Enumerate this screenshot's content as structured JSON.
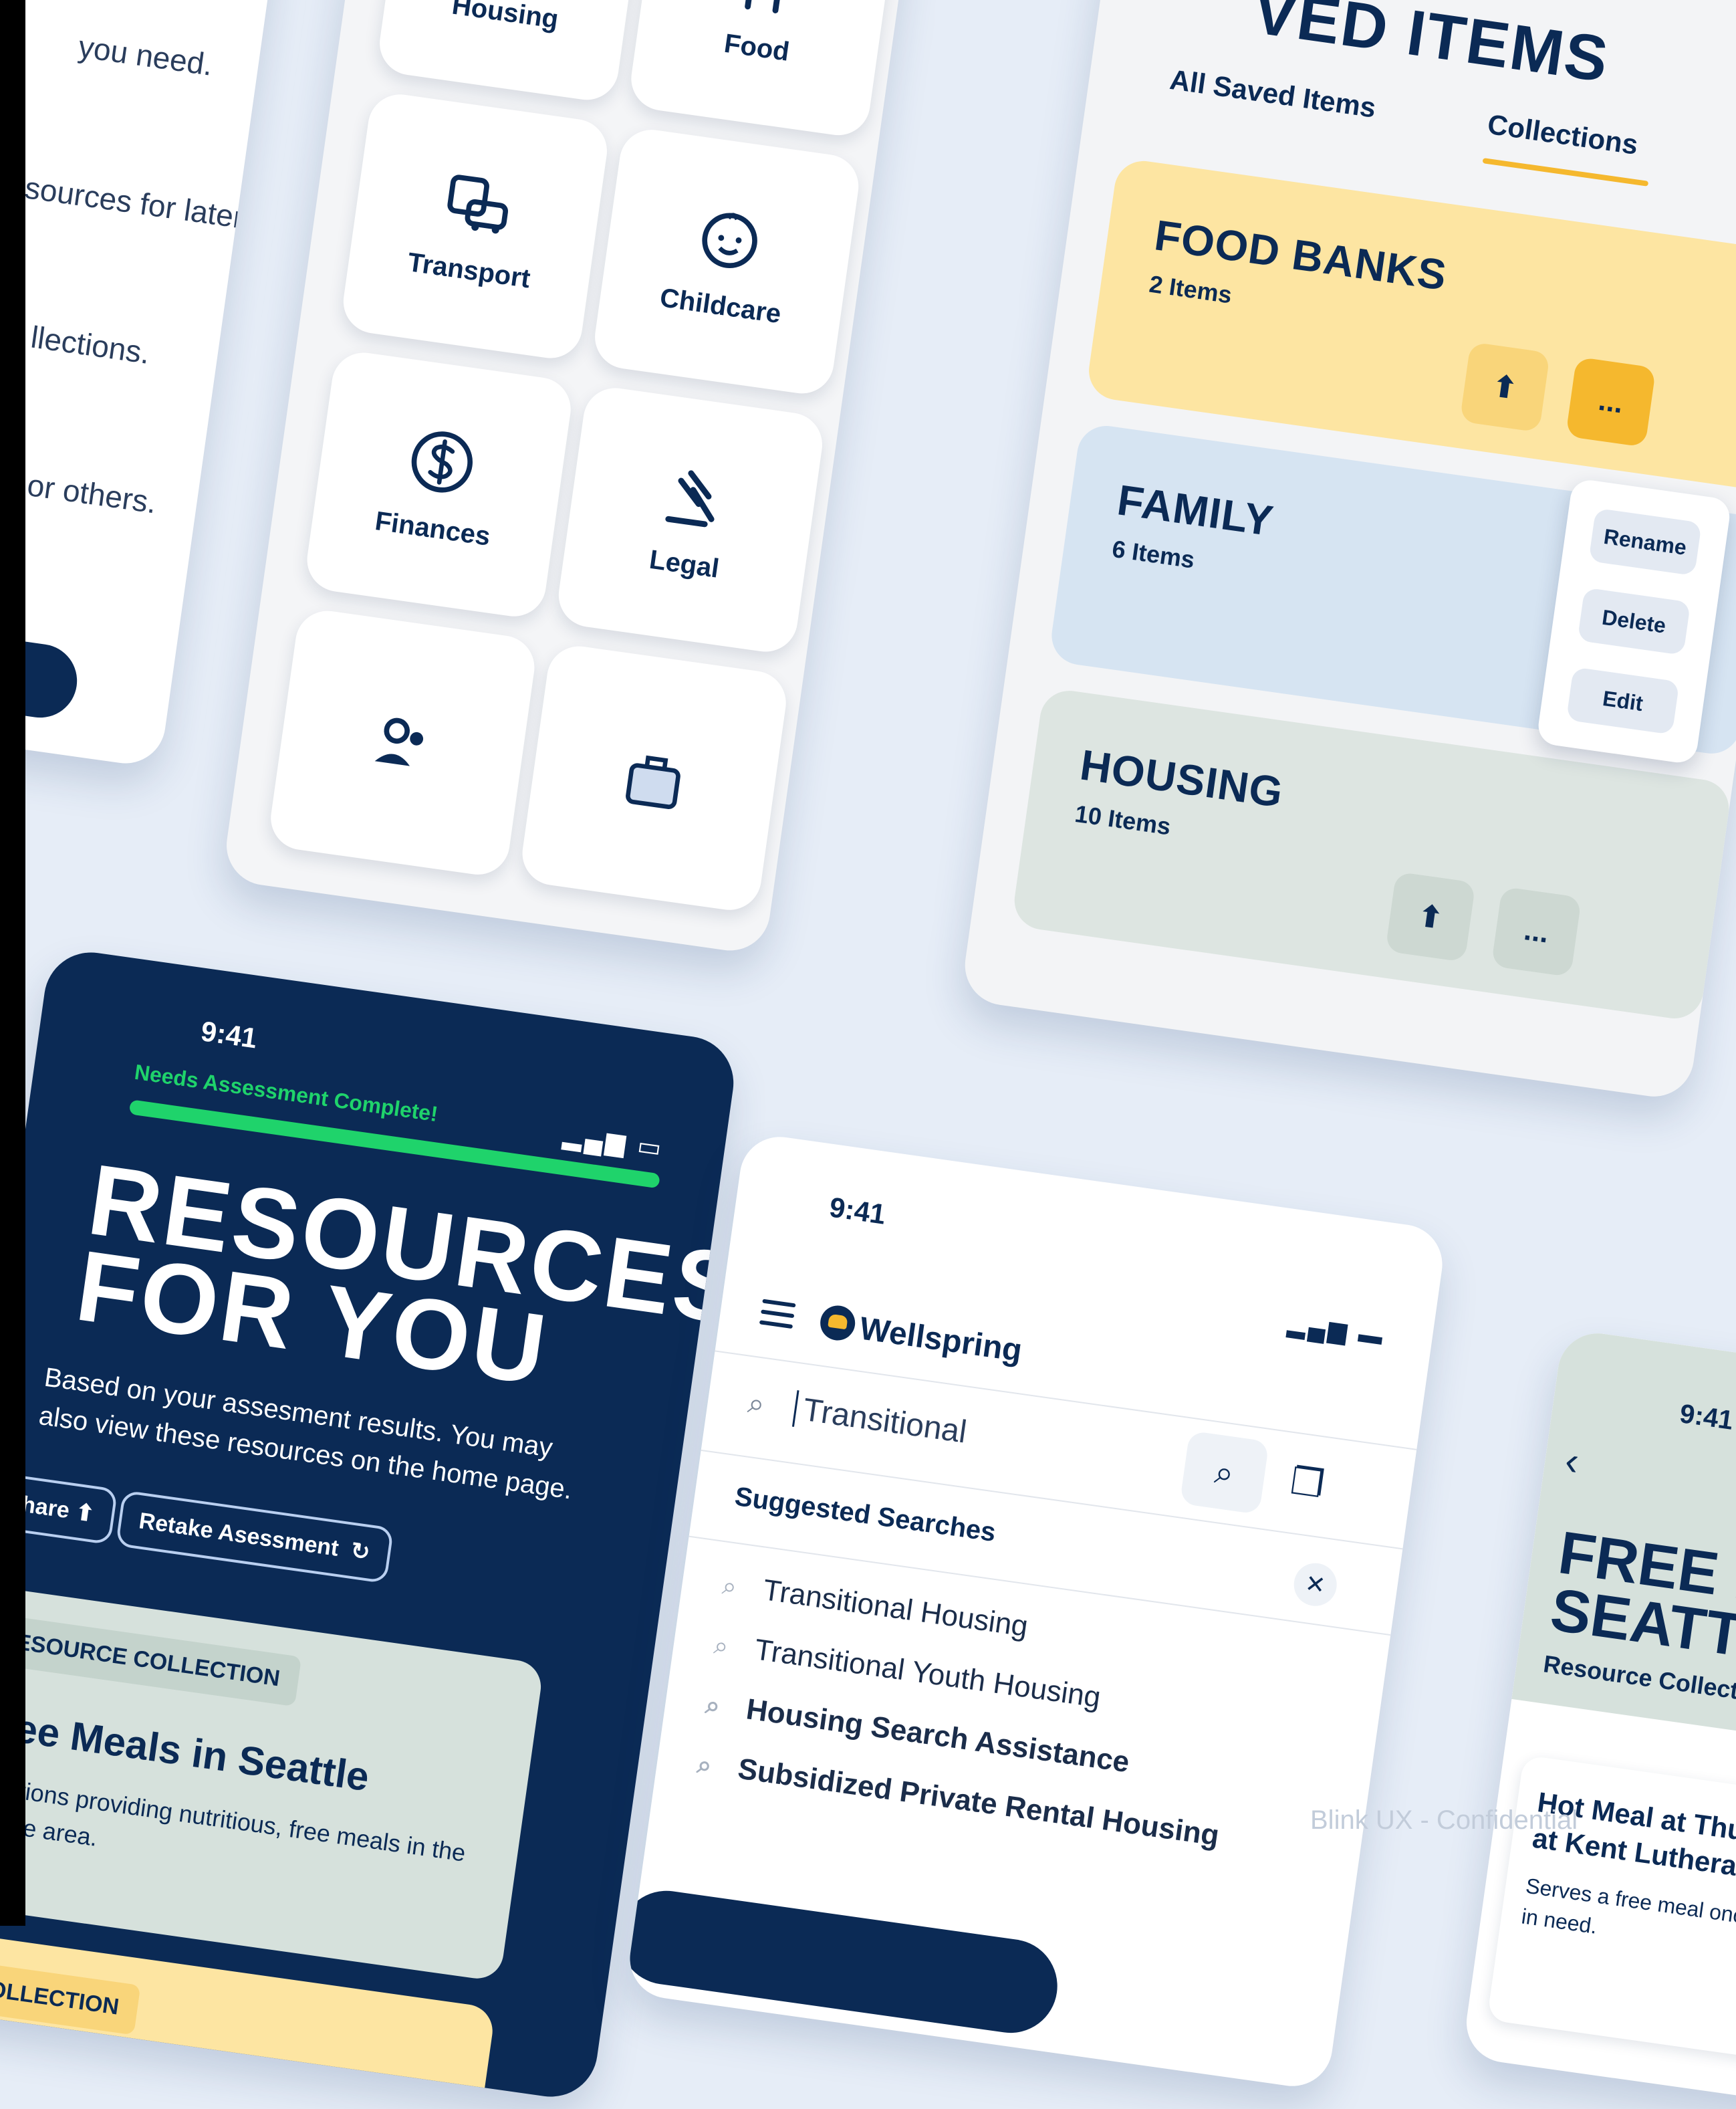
{
  "intro_card": {
    "lines": [
      "you need.",
      "sources for later.",
      "llections.",
      "f or others."
    ]
  },
  "categories": {
    "items": [
      {
        "label": "Housing",
        "icon": "house-icon"
      },
      {
        "label": "Food",
        "icon": "fork-knife-icon"
      },
      {
        "label": "Transport",
        "icon": "bus-car-icon"
      },
      {
        "label": "Childcare",
        "icon": "baby-face-icon"
      },
      {
        "label": "Finances",
        "icon": "dollar-circle-icon"
      },
      {
        "label": "Legal",
        "icon": "gavel-icon"
      }
    ]
  },
  "saved": {
    "title": "VED ITEMS",
    "tabs": [
      "All Saved Items",
      "Collections"
    ],
    "collections": [
      {
        "name": "FOOD BANKS",
        "count": "2 Items",
        "color": "#fde5a2"
      },
      {
        "name": "FAMILY",
        "count": "6 Items",
        "color": "#d6e4f2"
      },
      {
        "name": "HOUSING",
        "count": "10 Items",
        "color": "#dde5e1"
      }
    ],
    "menu": [
      "Rename",
      "Delete",
      "Edit"
    ],
    "more_label": "..."
  },
  "resources": {
    "time": "9:41",
    "progress_label": "Needs Assessment Complete!",
    "progress": 1.0,
    "heading_line1": "RESOURCES",
    "heading_line2": "FOR YOU",
    "subtitle": "Based on your assesment results. You may also view these resources on the home page.",
    "share_label": "Share",
    "retake_label": "Retake Asessment",
    "collection1_tag": "RESOURCE COLLECTION",
    "collection1_title": "Free Meals in Seattle",
    "collection1_desc": "Locations providing nutritious, free meals in the Seattle area.",
    "collection2_tag": "E COLLECTION"
  },
  "search": {
    "time": "9:41",
    "brand": "Wellspring",
    "query": "Transitional",
    "suggested_heading": "Suggested Searches",
    "suggestions": [
      "Transitional Housing",
      "Transitional Youth Housing",
      "Housing Search Assistance",
      "Subsidized Private Rental Housing"
    ]
  },
  "meals": {
    "time": "9:41",
    "heading_line1": "FREE M",
    "heading_line2": "SEATTLE",
    "collection_label": "Resource Collection",
    "item_title_line1": "Hot Meal at Thur",
    "item_title_line2": "at Kent Lutheran C",
    "item_desc_line1": "Serves a free meal once a",
    "item_desc_line2": "in need."
  },
  "watermark": "Blink UX - Confidential"
}
